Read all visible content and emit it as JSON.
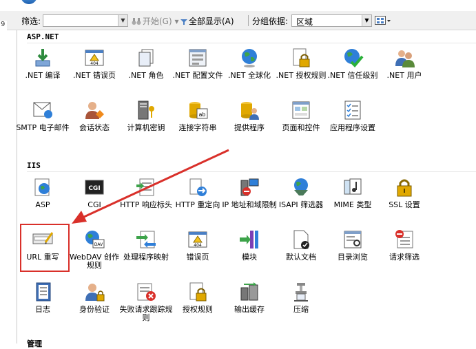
{
  "toolbar": {
    "filter_label": "筛选:",
    "go_label": "开始(G)",
    "show_all_label": "全部显示(A)",
    "group_by_label": "分组依据:",
    "group_by_value": "区域"
  },
  "groups": [
    {
      "title": "ASP.NET",
      "items": [
        {
          "label": ".NET 编译",
          "icon": "download-arrow-icon"
        },
        {
          "label": ".NET 错误页",
          "icon": "error-404-icon"
        },
        {
          "label": ".NET 角色",
          "icon": "documents-icon"
        },
        {
          "label": ".NET 配置文件",
          "icon": "config-window-icon"
        },
        {
          "label": ".NET 全球化",
          "icon": "globe-icon"
        },
        {
          "label": ".NET 授权规则",
          "icon": "lock-document-icon"
        },
        {
          "label": ".NET 信任级别",
          "icon": "globe-check-icon"
        },
        {
          "label": ".NET 用户",
          "icon": "users-icon"
        },
        {
          "label": "SMTP 电子邮件",
          "icon": "email-icon"
        },
        {
          "label": "会话状态",
          "icon": "session-user-icon"
        },
        {
          "label": "计算机密钥",
          "icon": "machine-key-icon"
        },
        {
          "label": "连接字符串",
          "icon": "connection-string-icon"
        },
        {
          "label": "提供程序",
          "icon": "providers-icon"
        },
        {
          "label": "页面和控件",
          "icon": "pages-controls-icon"
        },
        {
          "label": "应用程序设置",
          "icon": "app-settings-icon"
        }
      ]
    },
    {
      "title": "IIS",
      "items": [
        {
          "label": "ASP",
          "icon": "asp-icon"
        },
        {
          "label": "CGI",
          "icon": "cgi-icon"
        },
        {
          "label": "HTTP 响应标头",
          "icon": "http-headers-icon"
        },
        {
          "label": "HTTP 重定向",
          "icon": "http-redirect-icon"
        },
        {
          "label": "IP 地址和域限制",
          "icon": "ip-restrictions-icon"
        },
        {
          "label": "ISAPI 筛选器",
          "icon": "isapi-filter-icon"
        },
        {
          "label": "MIME 类型",
          "icon": "mime-types-icon"
        },
        {
          "label": "SSL 设置",
          "icon": "ssl-lock-icon"
        },
        {
          "label": "URL 重写",
          "icon": "url-rewrite-icon"
        },
        {
          "label": "WebDAV 创作规则",
          "icon": "webdav-icon"
        },
        {
          "label": "处理程序映射",
          "icon": "handler-mappings-icon"
        },
        {
          "label": "错误页",
          "icon": "error-pages-icon"
        },
        {
          "label": "模块",
          "icon": "modules-icon"
        },
        {
          "label": "默认文档",
          "icon": "default-document-icon"
        },
        {
          "label": "目录浏览",
          "icon": "directory-browsing-icon"
        },
        {
          "label": "请求筛选",
          "icon": "request-filtering-icon"
        },
        {
          "label": "日志",
          "icon": "logging-icon"
        },
        {
          "label": "身份验证",
          "icon": "authentication-icon"
        },
        {
          "label": "失败请求跟踪规则",
          "icon": "failed-request-icon"
        },
        {
          "label": "授权规则",
          "icon": "authorization-icon"
        },
        {
          "label": "输出缓存",
          "icon": "output-cache-icon"
        },
        {
          "label": "压缩",
          "icon": "compression-icon"
        }
      ]
    },
    {
      "title": "管理"
    }
  ],
  "left_edge_digit": "9",
  "colors": {
    "highlight": "#d9302a",
    "arrow": "#d9302a"
  }
}
